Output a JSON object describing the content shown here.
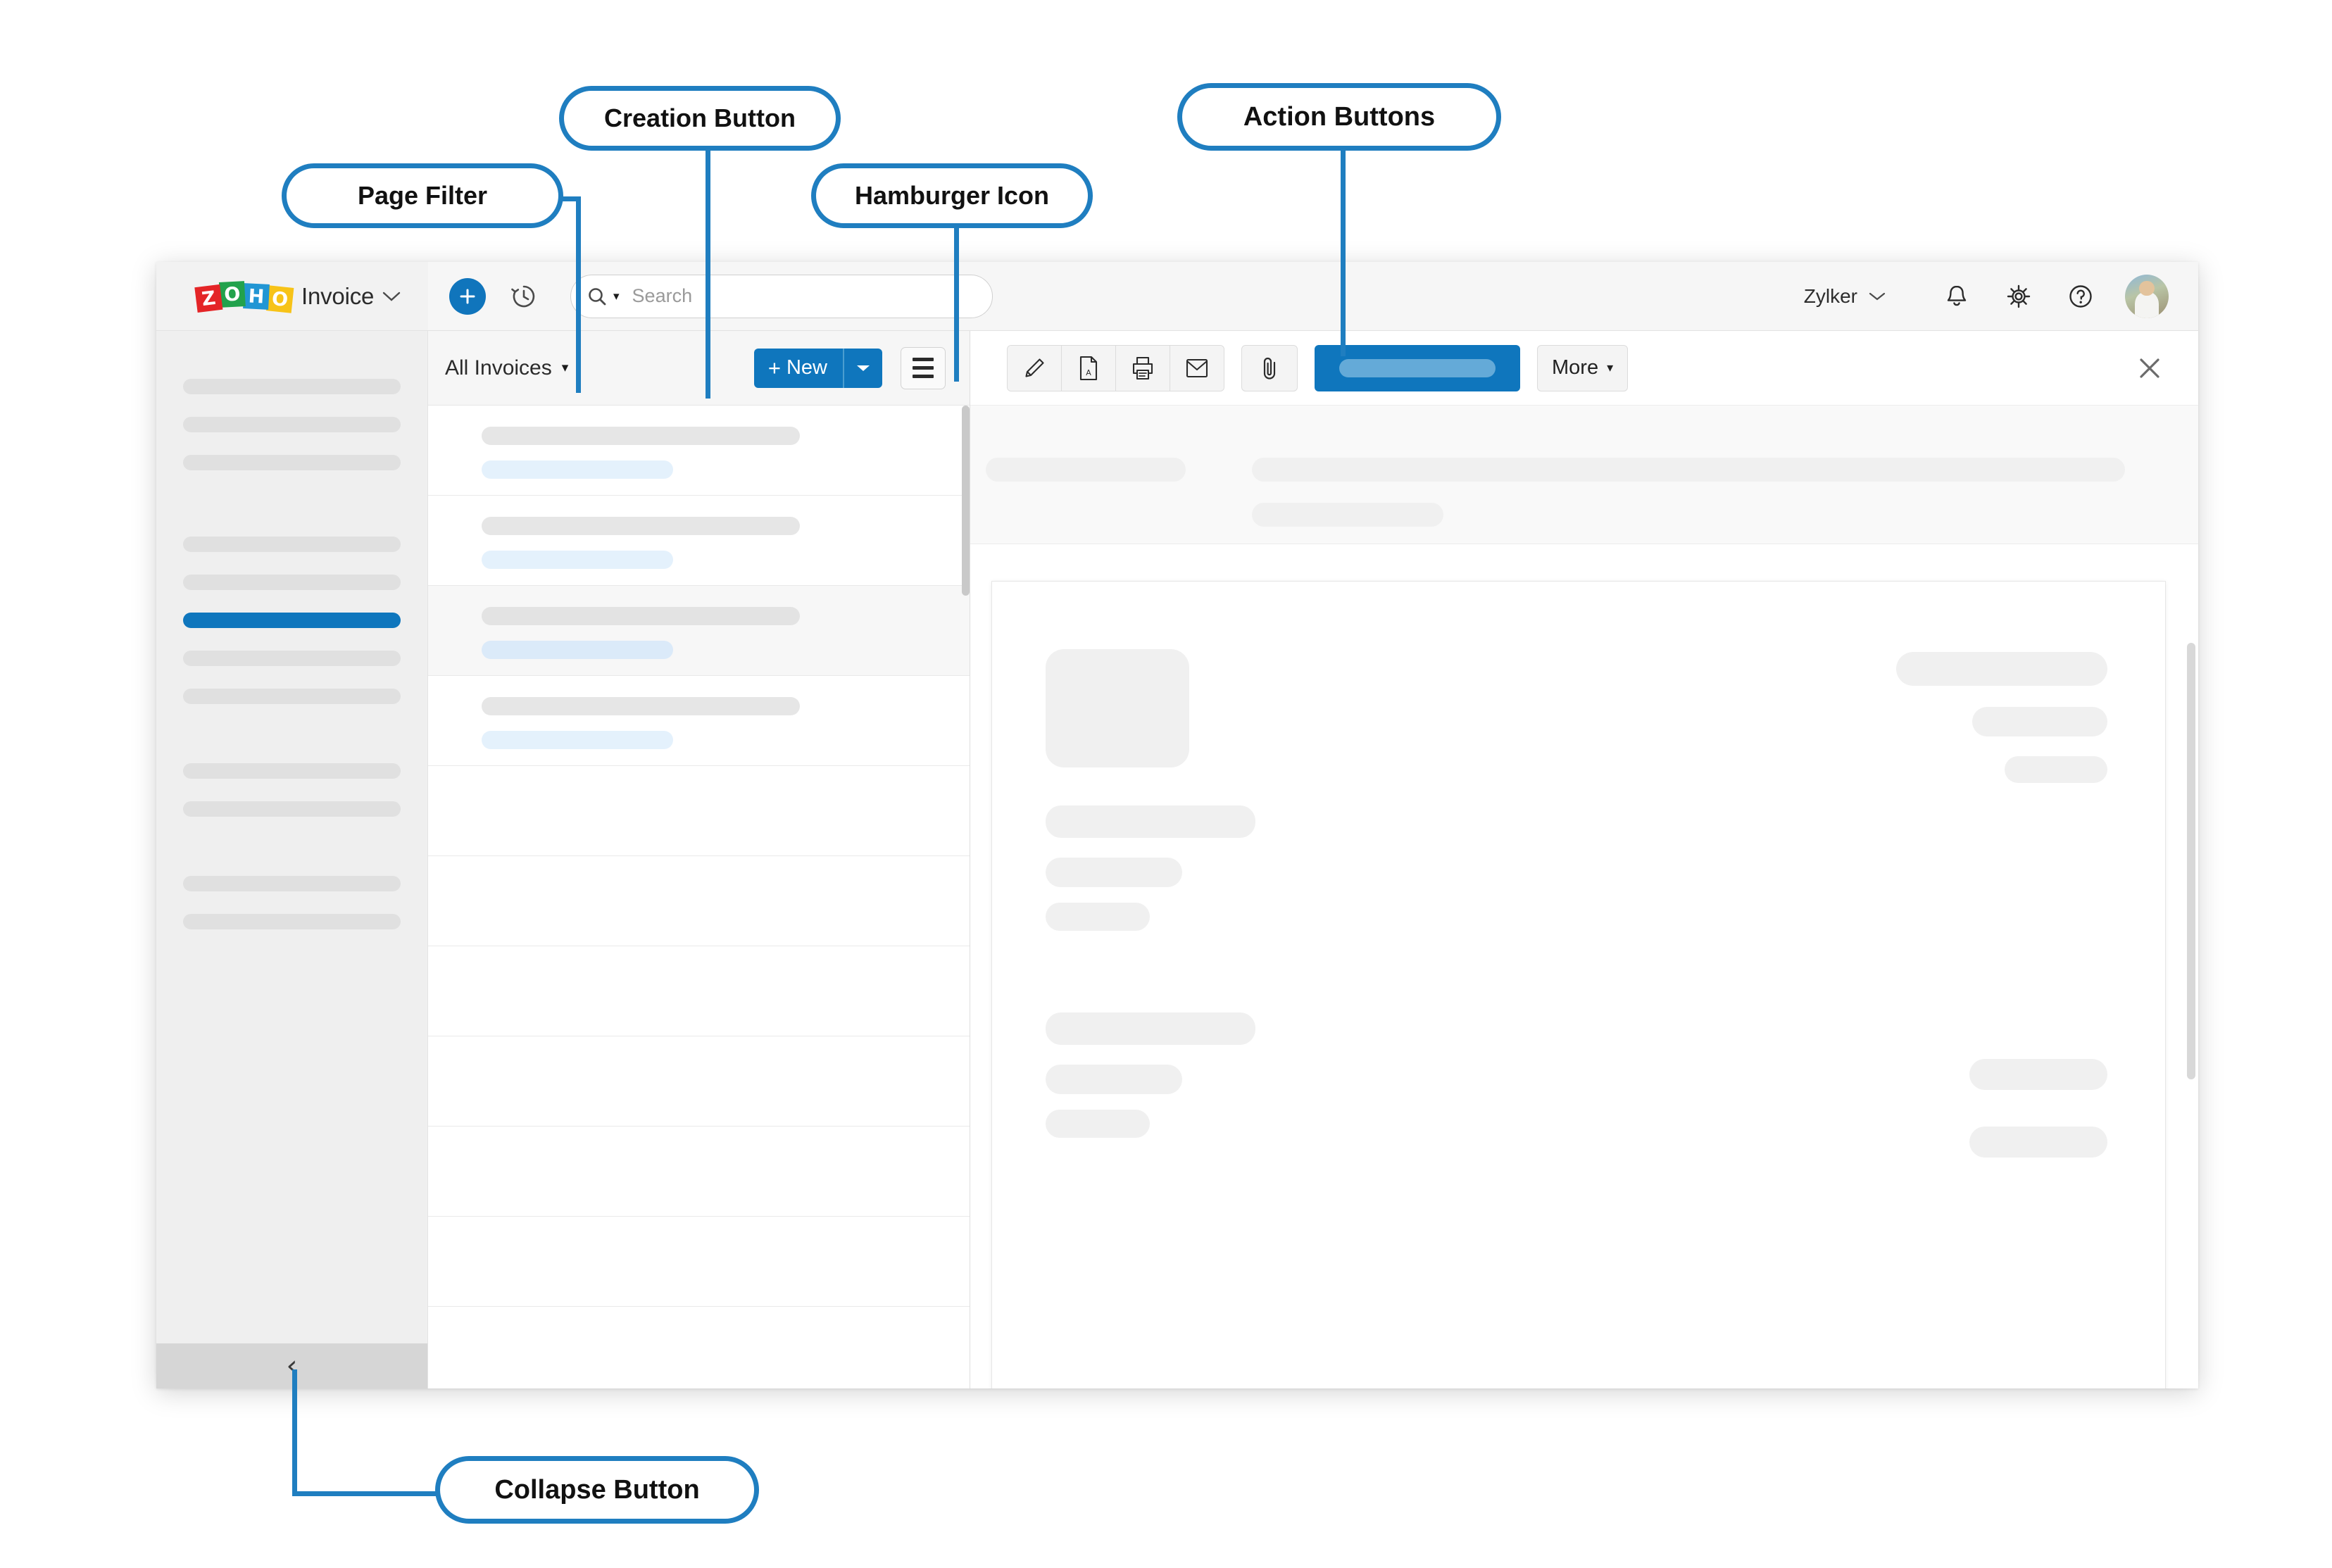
{
  "annotations": [
    {
      "id": "page-filter",
      "label": "Page Filter"
    },
    {
      "id": "creation-button",
      "label": "Creation Button"
    },
    {
      "id": "hamburger-icon",
      "label": "Hamburger Icon"
    },
    {
      "id": "action-buttons",
      "label": "Action Buttons"
    },
    {
      "id": "collapse-button",
      "label": "Collapse Button"
    }
  ],
  "colors": {
    "accent_blue": "#1f7ec0",
    "brand_blue": "#0f76bd",
    "active_item": "#0f76bd",
    "skeleton_gray": "#e0e0e0",
    "skeleton_blue": "#e4f1fc",
    "header_bg": "#f2f2f2",
    "sidebar_bg": "#efefef",
    "collapse_bar_bg": "#d6d6d6",
    "logo_red": "#e42527",
    "logo_green": "#22a24c",
    "logo_blue": "#2196d4",
    "logo_yellow": "#f7c318"
  },
  "header": {
    "logo_letters": [
      "Z",
      "O",
      "H",
      "O"
    ],
    "brand_name": "Invoice",
    "brand_caret": "⌄",
    "plus_icon": "plus-icon",
    "history_icon": "history-icon",
    "org_name": "Zylker",
    "org_caret": "⌄",
    "notifications_icon": "bell-icon",
    "settings_icon": "gear-icon",
    "help_icon": "help-icon",
    "avatar_label": "user-avatar"
  },
  "search": {
    "icon": "search-icon",
    "caret": "▾",
    "placeholder": "Search",
    "value": ""
  },
  "sidebar": {
    "items": [
      {
        "width_pct": 100,
        "active": false
      },
      {
        "width_pct": 100,
        "active": false
      },
      {
        "width_pct": 100,
        "active": false
      },
      {
        "spacer": true
      },
      {
        "width_pct": 100,
        "active": false
      },
      {
        "width_pct": 100,
        "active": false
      },
      {
        "width_pct": 100,
        "active": true
      },
      {
        "width_pct": 100,
        "active": false
      },
      {
        "width_pct": 100,
        "active": false
      },
      {
        "spacer": true
      },
      {
        "width_pct": 100,
        "active": false
      },
      {
        "width_pct": 100,
        "active": false
      },
      {
        "spacer": true
      },
      {
        "width_pct": 100,
        "active": false
      },
      {
        "width_pct": 100,
        "active": false
      }
    ],
    "collapse_chevron": "‹"
  },
  "list_panel": {
    "filter_label": "All Invoices",
    "filter_caret": "▾",
    "new_button": {
      "plus": "+",
      "label": "New",
      "dropdown_caret": "▾"
    },
    "hamburger_label": "hamburger-icon",
    "rows": [
      {
        "filled": true,
        "selected": false
      },
      {
        "filled": true,
        "selected": false
      },
      {
        "filled": true,
        "selected": true
      },
      {
        "filled": true,
        "selected": false
      },
      {
        "filled": false,
        "selected": false
      },
      {
        "filled": false,
        "selected": false
      },
      {
        "filled": false,
        "selected": false
      },
      {
        "filled": false,
        "selected": false
      },
      {
        "filled": false,
        "selected": false
      },
      {
        "filled": false,
        "selected": false
      },
      {
        "filled": false,
        "selected": false
      }
    ]
  },
  "detail_panel": {
    "actions": [
      {
        "icon": "edit-pencil-icon",
        "label": "Edit"
      },
      {
        "icon": "pdf-file-icon",
        "label": "PDF"
      },
      {
        "icon": "printer-icon",
        "label": "Print"
      },
      {
        "icon": "email-icon",
        "label": "Email"
      }
    ],
    "attachment": {
      "icon": "paperclip-icon",
      "label": "Attach"
    },
    "primary_button_label": "",
    "more_label": "More",
    "more_caret": "▾",
    "close_icon": "close-icon"
  }
}
